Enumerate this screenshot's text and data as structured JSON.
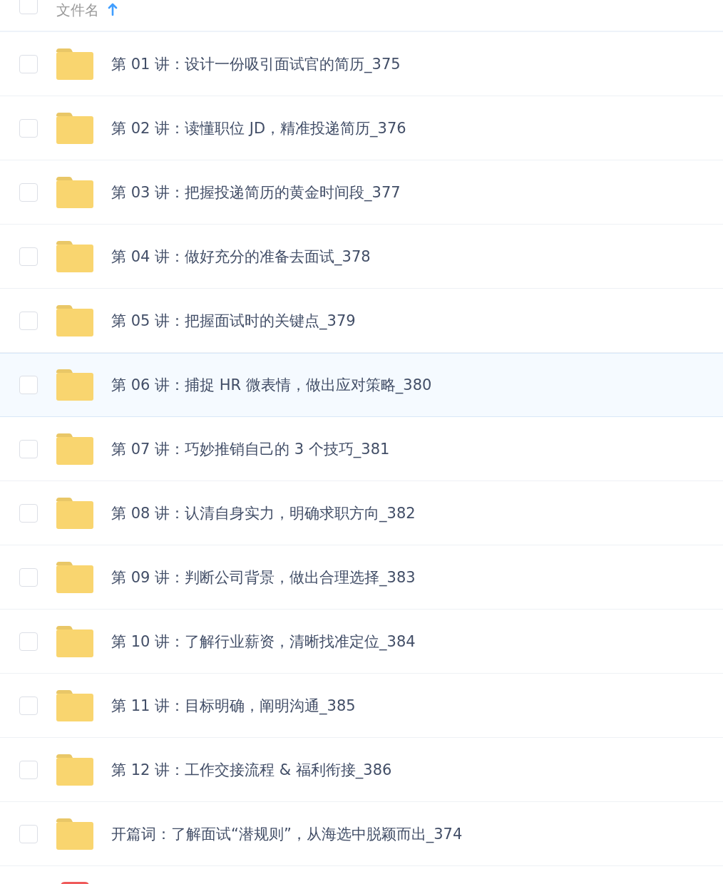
{
  "header": {
    "column": "文件名",
    "sort_ascending": true,
    "checked": false
  },
  "files": [
    {
      "kind": "folder",
      "name": "第 01 讲：设计一份吸引面试官的简历_375",
      "highlighted": false,
      "checked": false
    },
    {
      "kind": "folder",
      "name": "第 02 讲：读懂职位 JD，精准投递简历_376",
      "highlighted": false,
      "checked": false
    },
    {
      "kind": "folder",
      "name": "第 03 讲：把握投递简历的黄金时间段_377",
      "highlighted": false,
      "checked": false
    },
    {
      "kind": "folder",
      "name": "第 04 讲：做好充分的准备去面试_378",
      "highlighted": false,
      "checked": false
    },
    {
      "kind": "folder",
      "name": "第 05 讲：把握面试时的关键点_379",
      "highlighted": false,
      "checked": false
    },
    {
      "kind": "folder",
      "name": "第 06 讲：捕捉 HR 微表情，做出应对策略_380",
      "highlighted": true,
      "checked": false
    },
    {
      "kind": "folder",
      "name": "第 07 讲：巧妙推销自己的 3 个技巧_381",
      "highlighted": false,
      "checked": false
    },
    {
      "kind": "folder",
      "name": "第 08 讲：认清自身实力，明确求职方向_382",
      "highlighted": false,
      "checked": false
    },
    {
      "kind": "folder",
      "name": "第 09 讲：判断公司背景，做出合理选择_383",
      "highlighted": false,
      "checked": false
    },
    {
      "kind": "folder",
      "name": "第 10 讲：了解行业薪资，清晰找准定位_384",
      "highlighted": false,
      "checked": false
    },
    {
      "kind": "folder",
      "name": "第 11 讲：目标明确，阐明沟通_385",
      "highlighted": false,
      "checked": false
    },
    {
      "kind": "folder",
      "name": "第 12 讲：工作交接流程 & 福利衔接_386",
      "highlighted": false,
      "checked": false
    },
    {
      "kind": "folder",
      "name": "开篇词：了解面试“潜规则”，从海选中脱颖而出_374",
      "highlighted": false,
      "checked": false
    },
    {
      "kind": "file",
      "highlighted": false
    }
  ]
}
